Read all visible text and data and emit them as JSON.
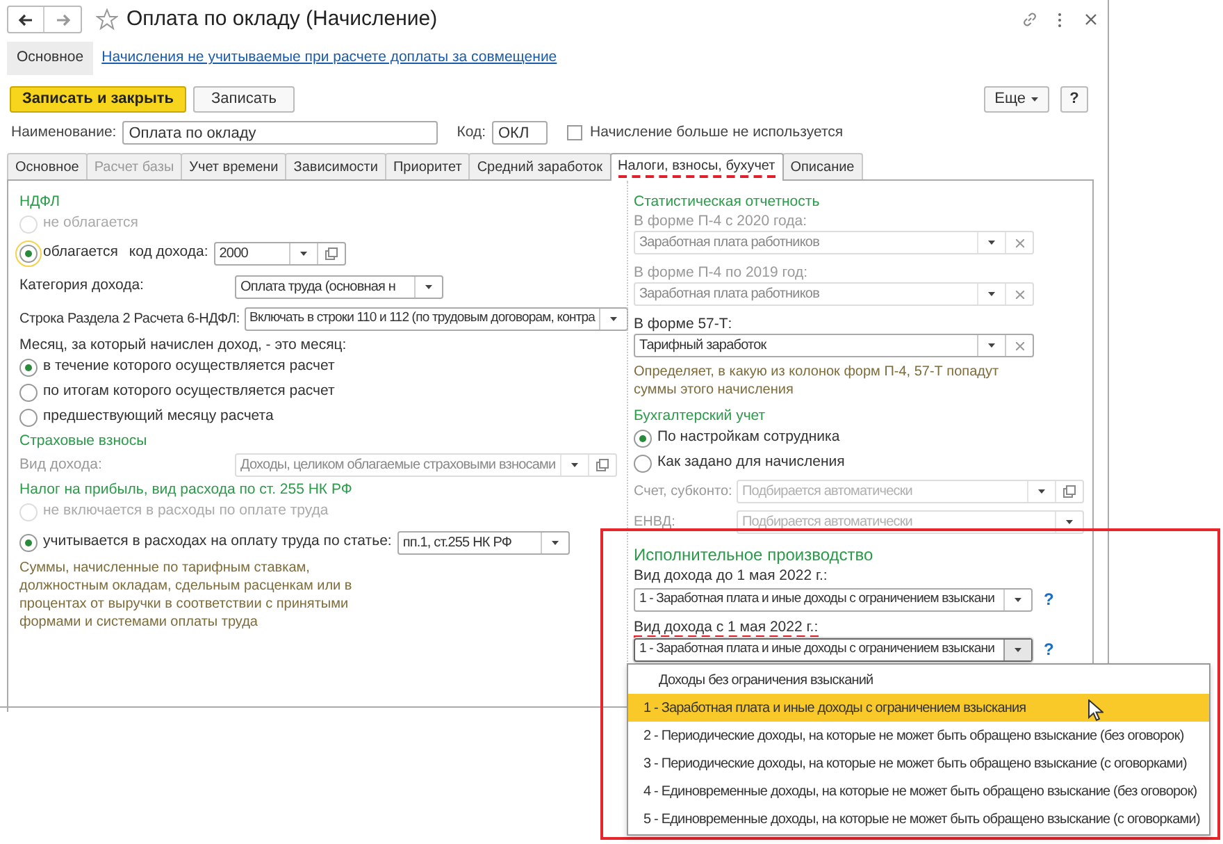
{
  "window": {
    "title": "Оплата по окладу (Начисление)"
  },
  "nav": {
    "section": "Основное",
    "link": "Начисления не учитываемые при расчете доплаты за совмещение"
  },
  "toolbar": {
    "primary": "Записать и закрыть",
    "secondary": "Записать",
    "more": "Еще",
    "help": "?"
  },
  "header": {
    "name_label": "Наименование:",
    "name_value": "Оплата по окладу",
    "code_label": "Код:",
    "code_value": "ОКЛ",
    "unused_label": "Начисление больше не используется",
    "unused_checked": false
  },
  "tabs": [
    {
      "label": "Основное",
      "selected": false,
      "disabled": false,
      "marked": false
    },
    {
      "label": "Расчет базы",
      "selected": false,
      "disabled": true,
      "marked": false
    },
    {
      "label": "Учет времени",
      "selected": false,
      "disabled": false,
      "marked": false
    },
    {
      "label": "Зависимости",
      "selected": false,
      "disabled": false,
      "marked": false
    },
    {
      "label": "Приоритет",
      "selected": false,
      "disabled": false,
      "marked": false
    },
    {
      "label": "Средний заработок",
      "selected": false,
      "disabled": false,
      "marked": false
    },
    {
      "label": "Налоги, взносы, бухучет",
      "selected": true,
      "disabled": false,
      "marked": true
    },
    {
      "label": "Описание",
      "selected": false,
      "disabled": false,
      "marked": false
    }
  ],
  "ndfl": {
    "title": "НДФЛ",
    "options": [
      {
        "label": "не облагается",
        "selected": false,
        "disabled": true
      },
      {
        "label": "облагается",
        "selected": true,
        "disabled": false
      }
    ],
    "code_label": "код дохода:",
    "code_value": "2000",
    "category_label": "Категория дохода:",
    "category_value": "Оплата труда (основная н",
    "row_label": "Строка Раздела 2 Расчета 6-НДФЛ:",
    "row_value": "Включать в строки 110 и 112 (по трудовым договорам, контра",
    "month_label": "Месяц, за который начислен доход, - это месяц:",
    "month_options": [
      {
        "label": "в течение которого осуществляется расчет",
        "selected": true
      },
      {
        "label": "по итогам которого осуществляется расчет",
        "selected": false
      },
      {
        "label": "предшествующий месяцу расчета",
        "selected": false
      }
    ]
  },
  "insurance": {
    "title": "Страховые взносы",
    "label": "Вид дохода:",
    "value": "Доходы, целиком облагаемые страховыми взносами",
    "disabled": true
  },
  "profit_tax": {
    "title": "Налог на прибыль, вид расхода по ст. 255 НК РФ",
    "options": [
      {
        "label": "не включается в расходы по оплате труда",
        "selected": false,
        "disabled": true
      },
      {
        "label": "учитывается в расходах на оплату труда по статье:",
        "selected": true,
        "disabled": false
      }
    ],
    "article_value": "пп.1, ст.255 НК РФ",
    "note": "Суммы, начисленные по тарифным ставкам, должностным окладам, сдельным расценкам или в процентах от выручки в соответствии с принятыми формами и системами оплаты труда"
  },
  "statistics": {
    "title": "Статистическая отчетность",
    "fields": [
      {
        "label": "В форме П-4 с 2020 года:",
        "value": "Заработная плата работников",
        "disabled": true
      },
      {
        "label": "В форме П-4 по 2019 год:",
        "value": "Заработная плата работников",
        "disabled": true
      },
      {
        "label": "В форме 57-Т:",
        "value": "Тарифный заработок",
        "disabled": false
      }
    ],
    "note": "Определяет, в какую из колонок форм П-4, 57-Т попадут суммы этого начисления"
  },
  "accounting": {
    "title": "Бухгалтерский учет",
    "options": [
      {
        "label": "По настройкам сотрудника",
        "selected": true
      },
      {
        "label": "Как задано для начисления",
        "selected": false
      }
    ],
    "fields": [
      {
        "label": "Счет, субконто:",
        "placeholder": "Подбирается автоматически",
        "kind": "open"
      },
      {
        "label": "ЕНВД:",
        "placeholder": "Подбирается автоматически",
        "kind": "plain"
      }
    ]
  },
  "enforcement": {
    "title": "Исполнительное производство",
    "highlighted": true,
    "fields": [
      {
        "label": "Вид дохода до 1 мая 2022 г.:",
        "value": "1 - Заработная плата и иные доходы с ограничением взыскани",
        "help": "?",
        "marked": false,
        "expanded": false
      },
      {
        "label": "Вид дохода с 1 мая 2022 г.:",
        "value": "1 - Заработная плата и иные доходы с ограничением взыскани",
        "help": "?",
        "marked": true,
        "expanded": true
      }
    ]
  },
  "dropdown": {
    "items": [
      {
        "label": "Доходы без ограничения взысканий",
        "selected": false,
        "kind": "empty"
      },
      {
        "label": "1 - Заработная плата и иные доходы с ограничением взыскания",
        "selected": true,
        "kind": "item"
      },
      {
        "label": "2 - Периодические доходы, на которые не может быть обращено взыскание (без оговорок)",
        "selected": false,
        "kind": "item"
      },
      {
        "label": "3 - Периодические доходы, на которые не может быть обращено взыскание (с оговорками)",
        "selected": false,
        "kind": "item"
      },
      {
        "label": "4 - Единовременные доходы, на которые не может быть обращено взыскание (без оговорок)",
        "selected": false,
        "kind": "item"
      },
      {
        "label": "5 - Единовременные доходы, на которые не может быть обращено взыскание (с оговорками)",
        "selected": false,
        "kind": "item"
      }
    ]
  }
}
